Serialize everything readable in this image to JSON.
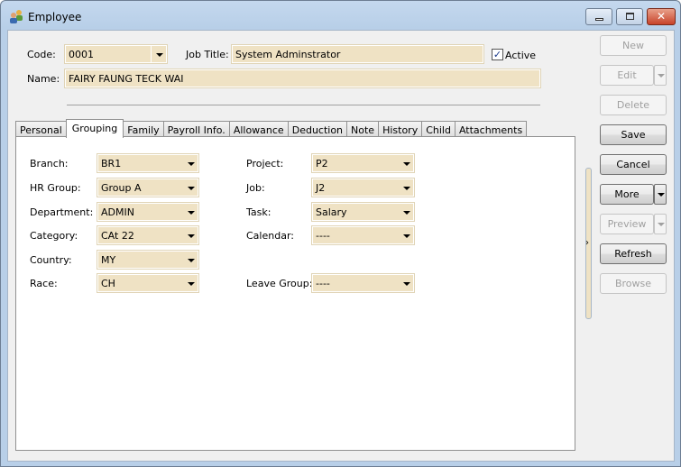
{
  "window": {
    "title": "Employee"
  },
  "header": {
    "code_label": "Code:",
    "code_value": "0001",
    "job_title_label": "Job Title:",
    "job_title_value": "System Adminstrator",
    "active_label": "Active",
    "active_checked": true,
    "name_label": "Name:",
    "name_value": "FAIRY FAUNG TECK WAI"
  },
  "tabs": [
    "Personal",
    "Grouping",
    "Family",
    "Payroll Info.",
    "Allowance",
    "Deduction",
    "Note",
    "History",
    "Child",
    "Attachments"
  ],
  "active_tab": "Grouping",
  "grouping": {
    "left": [
      {
        "label": "Branch:",
        "value": "BR1"
      },
      {
        "label": "HR Group:",
        "value": "Group A"
      },
      {
        "label": "Department:",
        "value": "ADMIN"
      },
      {
        "label": "Category:",
        "value": "CAt 22"
      },
      {
        "label": "Country:",
        "value": "MY"
      },
      {
        "label": "Race:",
        "value": "CH"
      }
    ],
    "right": [
      {
        "label": "Project:",
        "value": "P2"
      },
      {
        "label": "Job:",
        "value": "J2"
      },
      {
        "label": "Task:",
        "value": "Salary"
      },
      {
        "label": "Calendar:",
        "value": "----"
      },
      {
        "label": "Leave Group:",
        "value": "----"
      }
    ]
  },
  "buttons": {
    "new": "New",
    "edit": "Edit",
    "delete": "Delete",
    "save": "Save",
    "cancel": "Cancel",
    "more": "More",
    "preview": "Preview",
    "refresh": "Refresh",
    "browse": "Browse"
  }
}
